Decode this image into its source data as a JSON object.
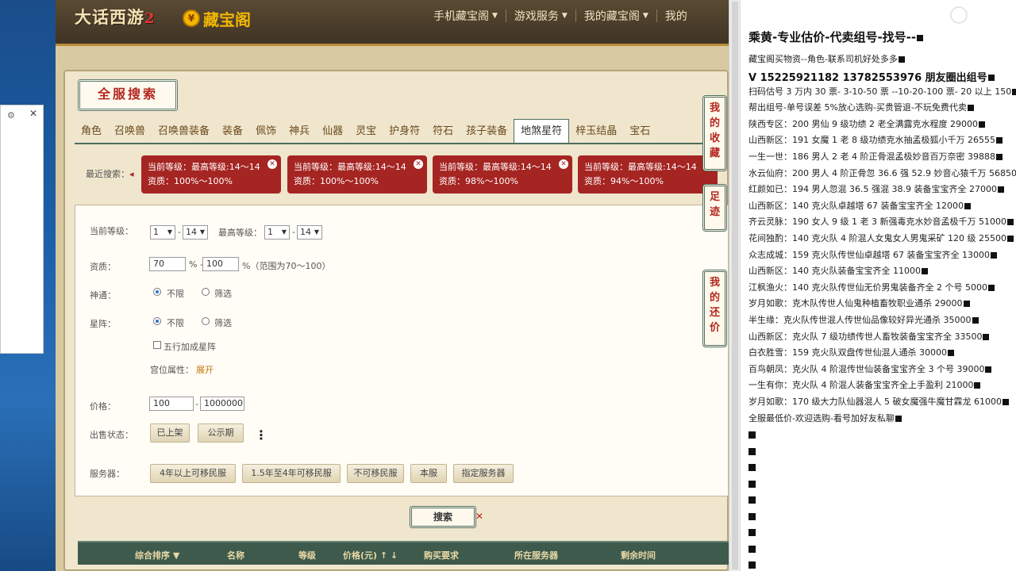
{
  "desktop": {
    "mini_window_close": "✕",
    "mini_window_gear": "⚙"
  },
  "header": {
    "game_logo": "大话西游",
    "game_logo_num": "2",
    "cbg_logo": "藏宝阁",
    "nav": [
      "手机藏宝阁",
      "游戏服务",
      "我的藏宝阁",
      "我的"
    ]
  },
  "page": {
    "title": "全服搜索",
    "tabs": [
      "角色",
      "召唤兽",
      "召唤兽装备",
      "装备",
      "佩饰",
      "神兵",
      "仙器",
      "灵宝",
      "护身符",
      "符石",
      "孩子装备",
      "地煞星符",
      "梓玉结晶",
      "宝石"
    ],
    "active_tab": "地煞星符",
    "side_tabs": [
      "我的收藏",
      "足迹",
      "我的还价"
    ],
    "recent_label": "最近搜索：",
    "recent": [
      {
        "line1": "当前等级：最高等级:14～14",
        "line2": "资质：100%～100%"
      },
      {
        "line1": "当前等级：最高等级:14～14",
        "line2": "资质：100%～100%"
      },
      {
        "line1": "当前等级：最高等级:14～14",
        "line2": "资质：98%～100%"
      },
      {
        "line1": "当前等级：最高等级:14～14",
        "line2": "资质：94%～100%"
      }
    ]
  },
  "form": {
    "level_label": "当前等级：",
    "level_from": "1",
    "level_to": "14",
    "max_level_label": "最高等级：",
    "max_from": "1",
    "max_to": "14",
    "dash": "-",
    "quality_label": "资质：",
    "quality_from": "70",
    "quality_to": "100",
    "percent": "%",
    "quality_hint": "%（范围为70～100）",
    "shentong_label": "神通：",
    "xingzhen_label": "星阵：",
    "opt_any": "不限",
    "opt_filter": "筛选",
    "wuxing_label": "五行加成星阵",
    "gongwei_label": "宫位属性：",
    "gongwei_link": "展开",
    "price_label": "价格：",
    "price_from": "100",
    "price_to": "1000000",
    "status_label": "出售状态：",
    "status_opts": [
      "已上架",
      "公示期"
    ],
    "server_label": "服务器：",
    "server_opts": [
      "4年以上可移民服",
      "1.5年至4年可移民服",
      "不可移民服",
      "本服",
      "指定服务器"
    ],
    "more": "⋮",
    "search": "搜索"
  },
  "results_header": [
    "综合排序 ▼",
    "名称",
    "等级",
    "价格(元) ↑ ↓",
    "购买要求",
    "所在服务器",
    "剩余时间"
  ],
  "right_panel": {
    "title": "乘黄-专业估价-代卖组号-找号--",
    "lines": [
      {
        "text": "藏宝阁买物资--角色-联系司机好处多多",
        "bold": false
      },
      {
        "text": "V 15225921182   13782553976 朋友圈出组号",
        "bold": true
      },
      {
        "text": "扫码估号 3 万内 30 票-  3-10-50 票  --10-20-100 票- 20 以上 150",
        "bold": false
      },
      {
        "text": "帮出组号-单号误差 5%放心选购-买贵管退-不玩免费代卖",
        "bold": false
      },
      {
        "text": "陕西专区：200 男仙 9 级功绩 2 老全满露克水程度 29000",
        "bold": false
      },
      {
        "text": "山西新区：191 女魔 1 老 8 级功绩克水抽孟极狐小千万 26555",
        "bold": false
      },
      {
        "text": "一生一世：186 男人 2 老 4 阶正骨混孟极妙音百万奈密 39888",
        "bold": false
      },
      {
        "text": "水云仙府：200 男人 4 阶正骨忽 36.6 强 52.9 妙音心猿千万 56850",
        "bold": false
      },
      {
        "text": "红颜如已：194 男人忽混 36.5 强混 38.9 装备宝宝齐全 27000",
        "bold": false
      },
      {
        "text": "山西新区：140 克火队卓越塔 67 装备宝宝齐全 12000",
        "bold": false
      },
      {
        "text": "齐云灵脉：190 女人 9 级 1 老 3 新强毒克水妙音孟极千万 51000",
        "bold": false
      },
      {
        "text": "花间独酌：140 克火队 4 阶混人女鬼女人男鬼采矿 120 级 25500",
        "bold": false
      },
      {
        "text": "众志成城：159 克火队传世仙卓越塔 67 装备宝宝齐全 13000",
        "bold": false
      },
      {
        "text": "山西新区：140 克火队装备宝宝齐全 11000",
        "bold": false
      },
      {
        "text": "江枫渔火：140 克火队传世仙无价男鬼装备齐全 2 个号 5000",
        "bold": false
      },
      {
        "text": "岁月如歌：克木队传世人仙鬼种植畜牧职业通杀 29000",
        "bold": false
      },
      {
        "text": "半生缘：克火队传世混人传世仙品像较好异光通杀 35000",
        "bold": false
      },
      {
        "text": "山西新区：克火队 7 级功绩传世人畜牧装备宝宝齐全 33500",
        "bold": false
      },
      {
        "text": "白衣胜雪：159 克火队双盘传世仙混人通杀 30000",
        "bold": false
      },
      {
        "text": "百鸟朝凤：克火队 4 阶混传世仙装备宝宝齐全 3 个号 39000",
        "bold": false
      },
      {
        "text": "一生有你：克火队 4 阶混人装备宝宝齐全上手盈利 21000",
        "bold": false
      },
      {
        "text": "岁月如歌：170 级大力队仙器混人 5 破女魔强牛魔甘霖龙 61000",
        "bold": false
      },
      {
        "text": "全服最低价-欢迎选购-看号加好友私聊",
        "bold": false
      }
    ]
  },
  "colors": {
    "chip_red": "#a52522",
    "header_green": "#3d5a4d",
    "tab_text": "#6b4a1d"
  }
}
